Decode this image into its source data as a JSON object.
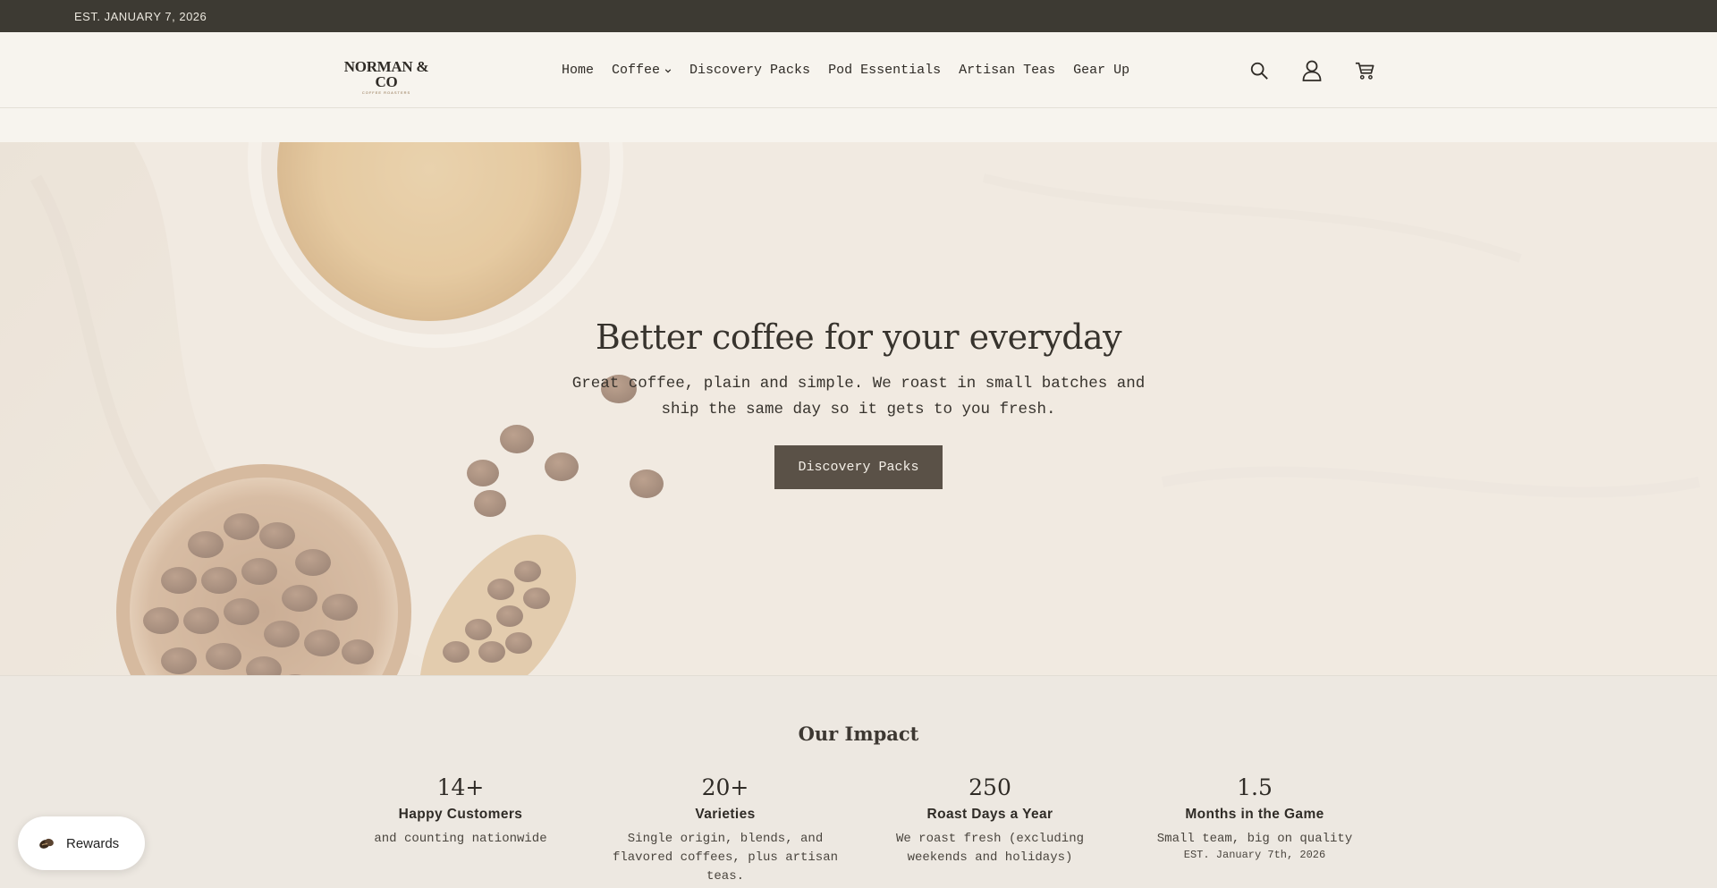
{
  "announcement": {
    "text": "EST. JANUARY 7, 2026"
  },
  "header": {
    "logo_text": "NORMAN & CO",
    "logo_sub": "COFFEE ROASTERS",
    "nav": [
      {
        "label": "Home"
      },
      {
        "label": "Coffee",
        "has_dropdown": true
      },
      {
        "label": "Discovery Packs"
      },
      {
        "label": "Pod Essentials"
      },
      {
        "label": "Artisan Teas"
      },
      {
        "label": "Gear Up"
      }
    ],
    "icons": [
      "search-icon",
      "account-icon",
      "cart-icon"
    ]
  },
  "hero": {
    "title": "Better coffee for your everyday",
    "subtitle": "Great coffee, plain and simple. We roast in small batches and ship the same day so it gets to you fresh.",
    "button_label": "Discovery Packs"
  },
  "impact": {
    "title": "Our Impact",
    "stats": [
      {
        "number": "14+",
        "label": "Happy Customers",
        "desc": "and counting nationwide",
        "note": ""
      },
      {
        "number": "20+",
        "label": "Varieties",
        "desc": "Single origin, blends, and flavored coffees, plus artisan teas.",
        "note": ""
      },
      {
        "number": "250",
        "label": "Roast Days a Year",
        "desc": "We roast fresh (excluding weekends and holidays)",
        "note": ""
      },
      {
        "number": "1.5",
        "label": "Months in the Game",
        "desc": "Small team, big on quality",
        "note": "EST. January 7th, 2026"
      }
    ]
  },
  "rewards": {
    "label": "Rewards"
  },
  "colors": {
    "announcement_bg": "#3d3a33",
    "button_bg": "#5a5147",
    "page_bg": "#f5f2ec"
  }
}
